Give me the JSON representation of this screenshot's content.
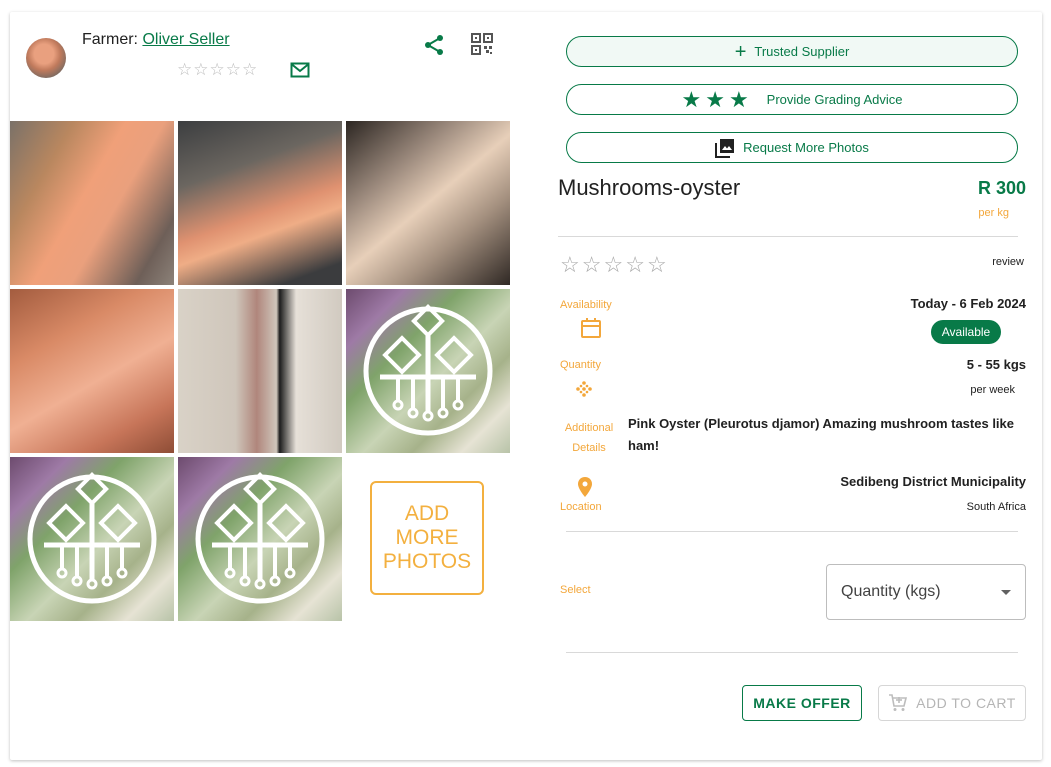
{
  "seller": {
    "label": "Farmer:",
    "name": "Oliver Seller",
    "rating": 0,
    "star_glyph": "☆"
  },
  "icons": {
    "share": "share-icon",
    "qr": "qr-code-icon",
    "mail": "mail-icon"
  },
  "gallery": {
    "photo_count": 8,
    "add_more_label": "ADD\nMORE\nPHOTOS"
  },
  "actions": {
    "trusted_supplier": "Trusted Supplier",
    "grading_advice": "Provide Grading Advice",
    "request_photos": "Request More Photos"
  },
  "product": {
    "title": "Mushrooms-oyster",
    "price": "R 300",
    "price_unit": "per kg",
    "review_label": "review",
    "rating": 0,
    "availability_label": "Availability",
    "availability_dates": "Today - 6 Feb 2024",
    "availability_status": "Available",
    "quantity_label": "Quantity",
    "quantity_range": "5 - 55 kgs",
    "quantity_period": "per week",
    "additional_label": "Additional\nDetails",
    "details": "Pink Oyster (Pleurotus djamor) Amazing mushroom tastes like ham!",
    "location_label": "Location",
    "location_area": "Sedibeng District Municipality",
    "location_country": "South Africa"
  },
  "order": {
    "select_label": "Select",
    "quantity_placeholder": "Quantity (kgs)",
    "make_offer": "MAKE OFFER",
    "add_to_cart": "ADD TO CART"
  },
  "colors": {
    "brand_green": "#087a48",
    "accent_orange": "#f3a73b"
  }
}
